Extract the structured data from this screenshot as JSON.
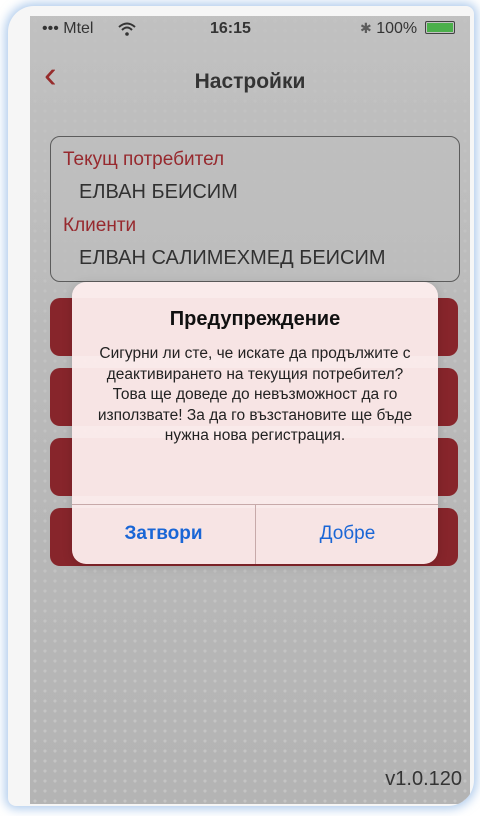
{
  "status_bar": {
    "carrier": "••• Mtel",
    "wifi_icon": "wifi-icon",
    "time": "16:15",
    "bluetooth_icon": "bluetooth-icon",
    "battery_text": "100%",
    "battery_color": "#3fbf3f"
  },
  "nav": {
    "back_glyph": "‹",
    "title": "Настройки"
  },
  "info": {
    "current_user_label": "Текущ потребител",
    "current_user_value": "ЕЛВАН БЕИСИМ",
    "clients_label": "Клиенти",
    "clients_value": "ЕЛВАН САЛИМЕХМЕД БЕИСИМ"
  },
  "version": "v1.0.120",
  "alert": {
    "title": "Предупреждение",
    "message": "Сигурни ли сте, че искате да продължите с деактивирането на текущия потребител? Това ще доведе до невъзможност да го използвате! За да го възстановите ще бъде нужна нова регистрация.",
    "close_label": "Затвори",
    "ok_label": "Добре",
    "button_color": "#1a66d6"
  },
  "colors": {
    "accent_red": "#a0141a",
    "button_red": "#8c0f17"
  }
}
